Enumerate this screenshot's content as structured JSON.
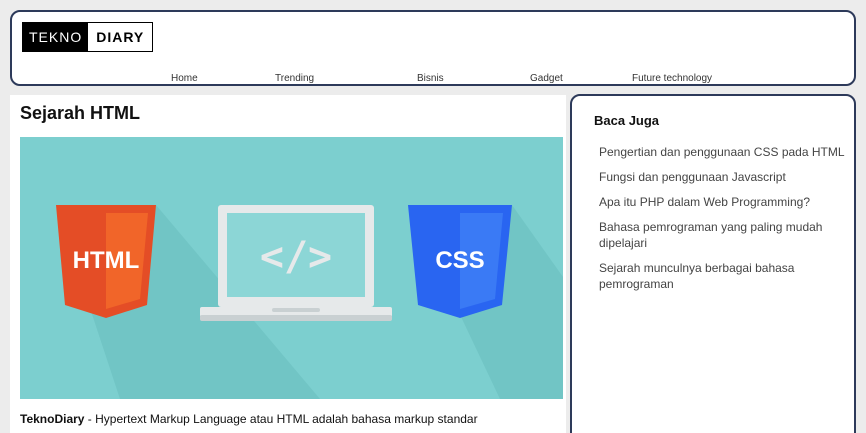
{
  "header": {
    "logo": {
      "left": "TEKNO",
      "right": "DIARY"
    },
    "nav": [
      "Home",
      "Trending",
      "Bisnis",
      "Gadget",
      "Future technology"
    ]
  },
  "article": {
    "title": "Sejarah HTML",
    "hero": {
      "left_badge": "HTML",
      "center_symbol": "</>",
      "right_badge": "CSS"
    },
    "lead_brand": "TeknoDiary",
    "lead_text": " - Hypertext Markup Language atau HTML adalah bahasa markup standar"
  },
  "sidebar": {
    "title": "Baca Juga",
    "links": [
      "Pengertian dan penggunaan CSS pada HTML",
      "Fungsi dan penggunaan Javascript",
      "Apa itu PHP dalam Web Programming?",
      "Bahasa pemrograman yang paling mudah dipelajari",
      "Sejarah munculnya berbagai bahasa pemrograman"
    ]
  },
  "colors": {
    "border": "#2d3a5a",
    "hero_bg": "#7ccfcf",
    "html_orange": "#e44d26",
    "css_blue": "#2965f1"
  }
}
